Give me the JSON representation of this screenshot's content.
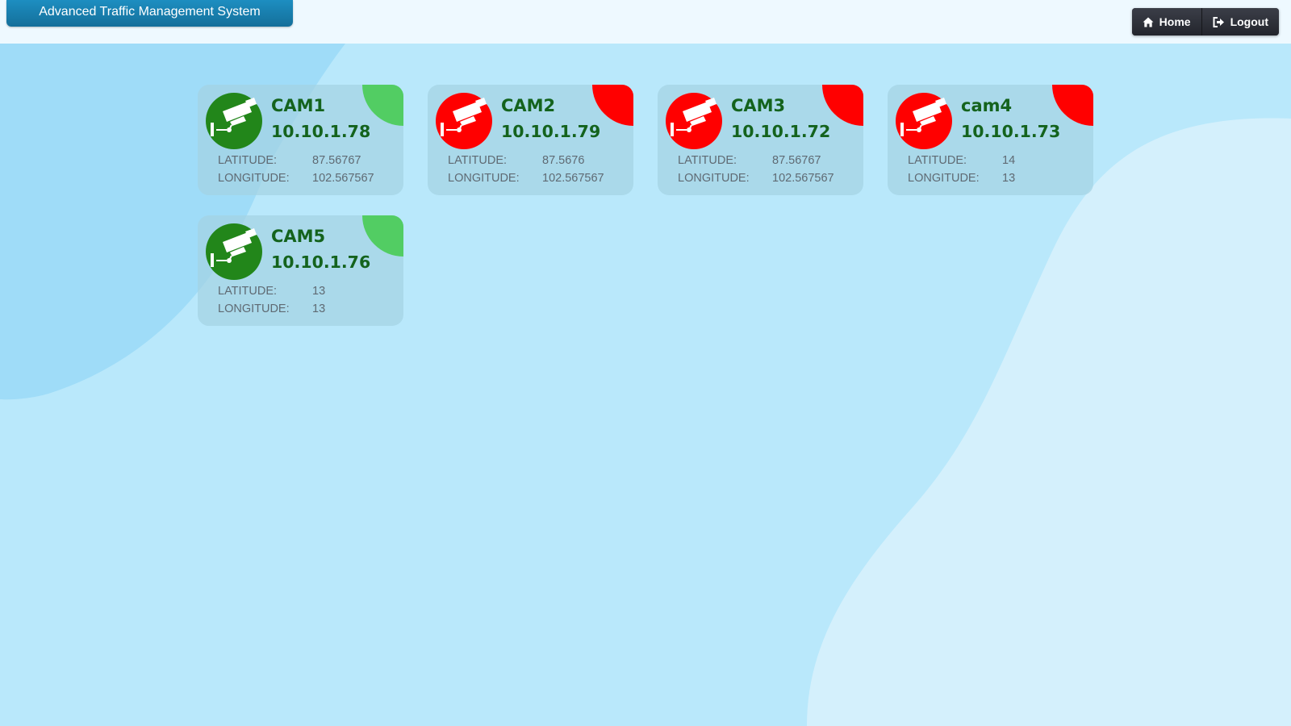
{
  "header": {
    "title": "Advanced Traffic Management System",
    "nav": [
      {
        "label": "Home",
        "icon": "home-icon"
      },
      {
        "label": "Logout",
        "icon": "logout-icon"
      }
    ]
  },
  "labels": {
    "latitude": "LATITUDE:",
    "longitude": "LONGITUDE:"
  },
  "status_colors": {
    "online": "#52cd63",
    "online_icon": "#22861a",
    "offline": "#ff0000"
  },
  "cameras": [
    {
      "name": "CAM1",
      "ip": "10.10.1.78",
      "latitude": "87.56767",
      "longitude": "102.567567",
      "status": "online",
      "icon": "cctv-camera-icon"
    },
    {
      "name": "CAM2",
      "ip": "10.10.1.79",
      "latitude": "87.5676",
      "longitude": "102.567567",
      "status": "offline",
      "icon": "cctv-camera-icon"
    },
    {
      "name": "CAM3",
      "ip": "10.10.1.72",
      "latitude": "87.56767",
      "longitude": "102.567567",
      "status": "offline",
      "icon": "cctv-camera-icon"
    },
    {
      "name": "cam4",
      "ip": "10.10.1.73",
      "latitude": "14",
      "longitude": "13",
      "status": "offline",
      "icon": "cctv-camera-icon"
    },
    {
      "name": "CAM5",
      "ip": "10.10.1.76",
      "latitude": "13",
      "longitude": "13",
      "status": "online",
      "icon": "cctv-camera-icon"
    }
  ]
}
